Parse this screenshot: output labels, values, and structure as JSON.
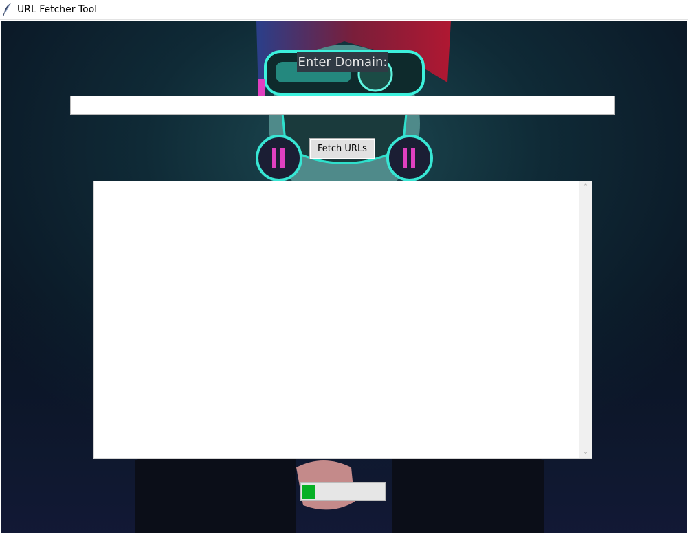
{
  "window": {
    "title": "URL Fetcher Tool",
    "icon": "feather-icon"
  },
  "form": {
    "label": "Enter Domain:",
    "domain_value": "",
    "fetch_label": "Fetch URLs"
  },
  "output": {
    "text": "",
    "scroll_up_icon": "chevron-up-icon",
    "scroll_down_icon": "chevron-down-icon"
  },
  "progress": {
    "value": 0.15,
    "color": "#06b025"
  },
  "colors": {
    "background": "#0b1a24",
    "accent_cyan": "#2de2d0",
    "accent_pink": "#e040c0",
    "label_bg": "#2f3a44"
  }
}
